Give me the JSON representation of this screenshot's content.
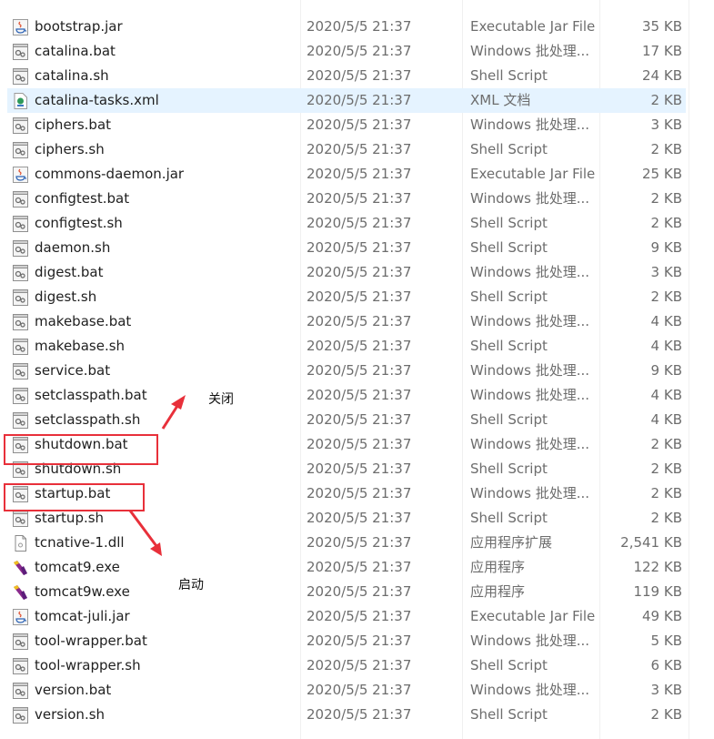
{
  "files": [
    {
      "name": "bootstrap.jar",
      "date": "2020/5/5 21:37",
      "type": "Executable Jar File",
      "size": "35 KB",
      "icon": "jar-icon"
    },
    {
      "name": "catalina.bat",
      "date": "2020/5/5 21:37",
      "type": "Windows 批处理...",
      "size": "17 KB",
      "icon": "script-icon"
    },
    {
      "name": "catalina.sh",
      "date": "2020/5/5 21:37",
      "type": "Shell Script",
      "size": "24 KB",
      "icon": "script-icon"
    },
    {
      "name": "catalina-tasks.xml",
      "date": "2020/5/5 21:37",
      "type": "XML 文档",
      "size": "2 KB",
      "icon": "xml-icon",
      "highlighted": true
    },
    {
      "name": "ciphers.bat",
      "date": "2020/5/5 21:37",
      "type": "Windows 批处理...",
      "size": "3 KB",
      "icon": "script-icon"
    },
    {
      "name": "ciphers.sh",
      "date": "2020/5/5 21:37",
      "type": "Shell Script",
      "size": "2 KB",
      "icon": "script-icon"
    },
    {
      "name": "commons-daemon.jar",
      "date": "2020/5/5 21:37",
      "type": "Executable Jar File",
      "size": "25 KB",
      "icon": "jar-icon"
    },
    {
      "name": "configtest.bat",
      "date": "2020/5/5 21:37",
      "type": "Windows 批处理...",
      "size": "2 KB",
      "icon": "script-icon"
    },
    {
      "name": "configtest.sh",
      "date": "2020/5/5 21:37",
      "type": "Shell Script",
      "size": "2 KB",
      "icon": "script-icon"
    },
    {
      "name": "daemon.sh",
      "date": "2020/5/5 21:37",
      "type": "Shell Script",
      "size": "9 KB",
      "icon": "script-icon"
    },
    {
      "name": "digest.bat",
      "date": "2020/5/5 21:37",
      "type": "Windows 批处理...",
      "size": "3 KB",
      "icon": "script-icon"
    },
    {
      "name": "digest.sh",
      "date": "2020/5/5 21:37",
      "type": "Shell Script",
      "size": "2 KB",
      "icon": "script-icon"
    },
    {
      "name": "makebase.bat",
      "date": "2020/5/5 21:37",
      "type": "Windows 批处理...",
      "size": "4 KB",
      "icon": "script-icon"
    },
    {
      "name": "makebase.sh",
      "date": "2020/5/5 21:37",
      "type": "Shell Script",
      "size": "4 KB",
      "icon": "script-icon"
    },
    {
      "name": "service.bat",
      "date": "2020/5/5 21:37",
      "type": "Windows 批处理...",
      "size": "9 KB",
      "icon": "script-icon"
    },
    {
      "name": "setclasspath.bat",
      "date": "2020/5/5 21:37",
      "type": "Windows 批处理...",
      "size": "4 KB",
      "icon": "script-icon"
    },
    {
      "name": "setclasspath.sh",
      "date": "2020/5/5 21:37",
      "type": "Shell Script",
      "size": "4 KB",
      "icon": "script-icon"
    },
    {
      "name": "shutdown.bat",
      "date": "2020/5/5 21:37",
      "type": "Windows 批处理...",
      "size": "2 KB",
      "icon": "script-icon"
    },
    {
      "name": "shutdown.sh",
      "date": "2020/5/5 21:37",
      "type": "Shell Script",
      "size": "2 KB",
      "icon": "script-icon"
    },
    {
      "name": "startup.bat",
      "date": "2020/5/5 21:37",
      "type": "Windows 批处理...",
      "size": "2 KB",
      "icon": "script-icon"
    },
    {
      "name": "startup.sh",
      "date": "2020/5/5 21:37",
      "type": "Shell Script",
      "size": "2 KB",
      "icon": "script-icon"
    },
    {
      "name": "tcnative-1.dll",
      "date": "2020/5/5 21:37",
      "type": "应用程序扩展",
      "size": "2,541 KB",
      "icon": "dll-icon"
    },
    {
      "name": "tomcat9.exe",
      "date": "2020/5/5 21:37",
      "type": "应用程序",
      "size": "122 KB",
      "icon": "tomcat-exe-icon"
    },
    {
      "name": "tomcat9w.exe",
      "date": "2020/5/5 21:37",
      "type": "应用程序",
      "size": "119 KB",
      "icon": "tomcat-exe-icon"
    },
    {
      "name": "tomcat-juli.jar",
      "date": "2020/5/5 21:37",
      "type": "Executable Jar File",
      "size": "49 KB",
      "icon": "jar-icon"
    },
    {
      "name": "tool-wrapper.bat",
      "date": "2020/5/5 21:37",
      "type": "Windows 批处理...",
      "size": "5 KB",
      "icon": "script-icon"
    },
    {
      "name": "tool-wrapper.sh",
      "date": "2020/5/5 21:37",
      "type": "Shell Script",
      "size": "6 KB",
      "icon": "script-icon"
    },
    {
      "name": "version.bat",
      "date": "2020/5/5 21:37",
      "type": "Windows 批处理...",
      "size": "3 KB",
      "icon": "script-icon"
    },
    {
      "name": "version.sh",
      "date": "2020/5/5 21:37",
      "type": "Shell Script",
      "size": "2 KB",
      "icon": "script-icon"
    }
  ],
  "annotations": {
    "shutdown_label": "关闭",
    "startup_label": "启动",
    "color": "#e8303a"
  },
  "colors": {
    "hover_row": "#e5f3ff",
    "name_text": "#1f1f1f",
    "meta_text": "#6d6d6d"
  }
}
